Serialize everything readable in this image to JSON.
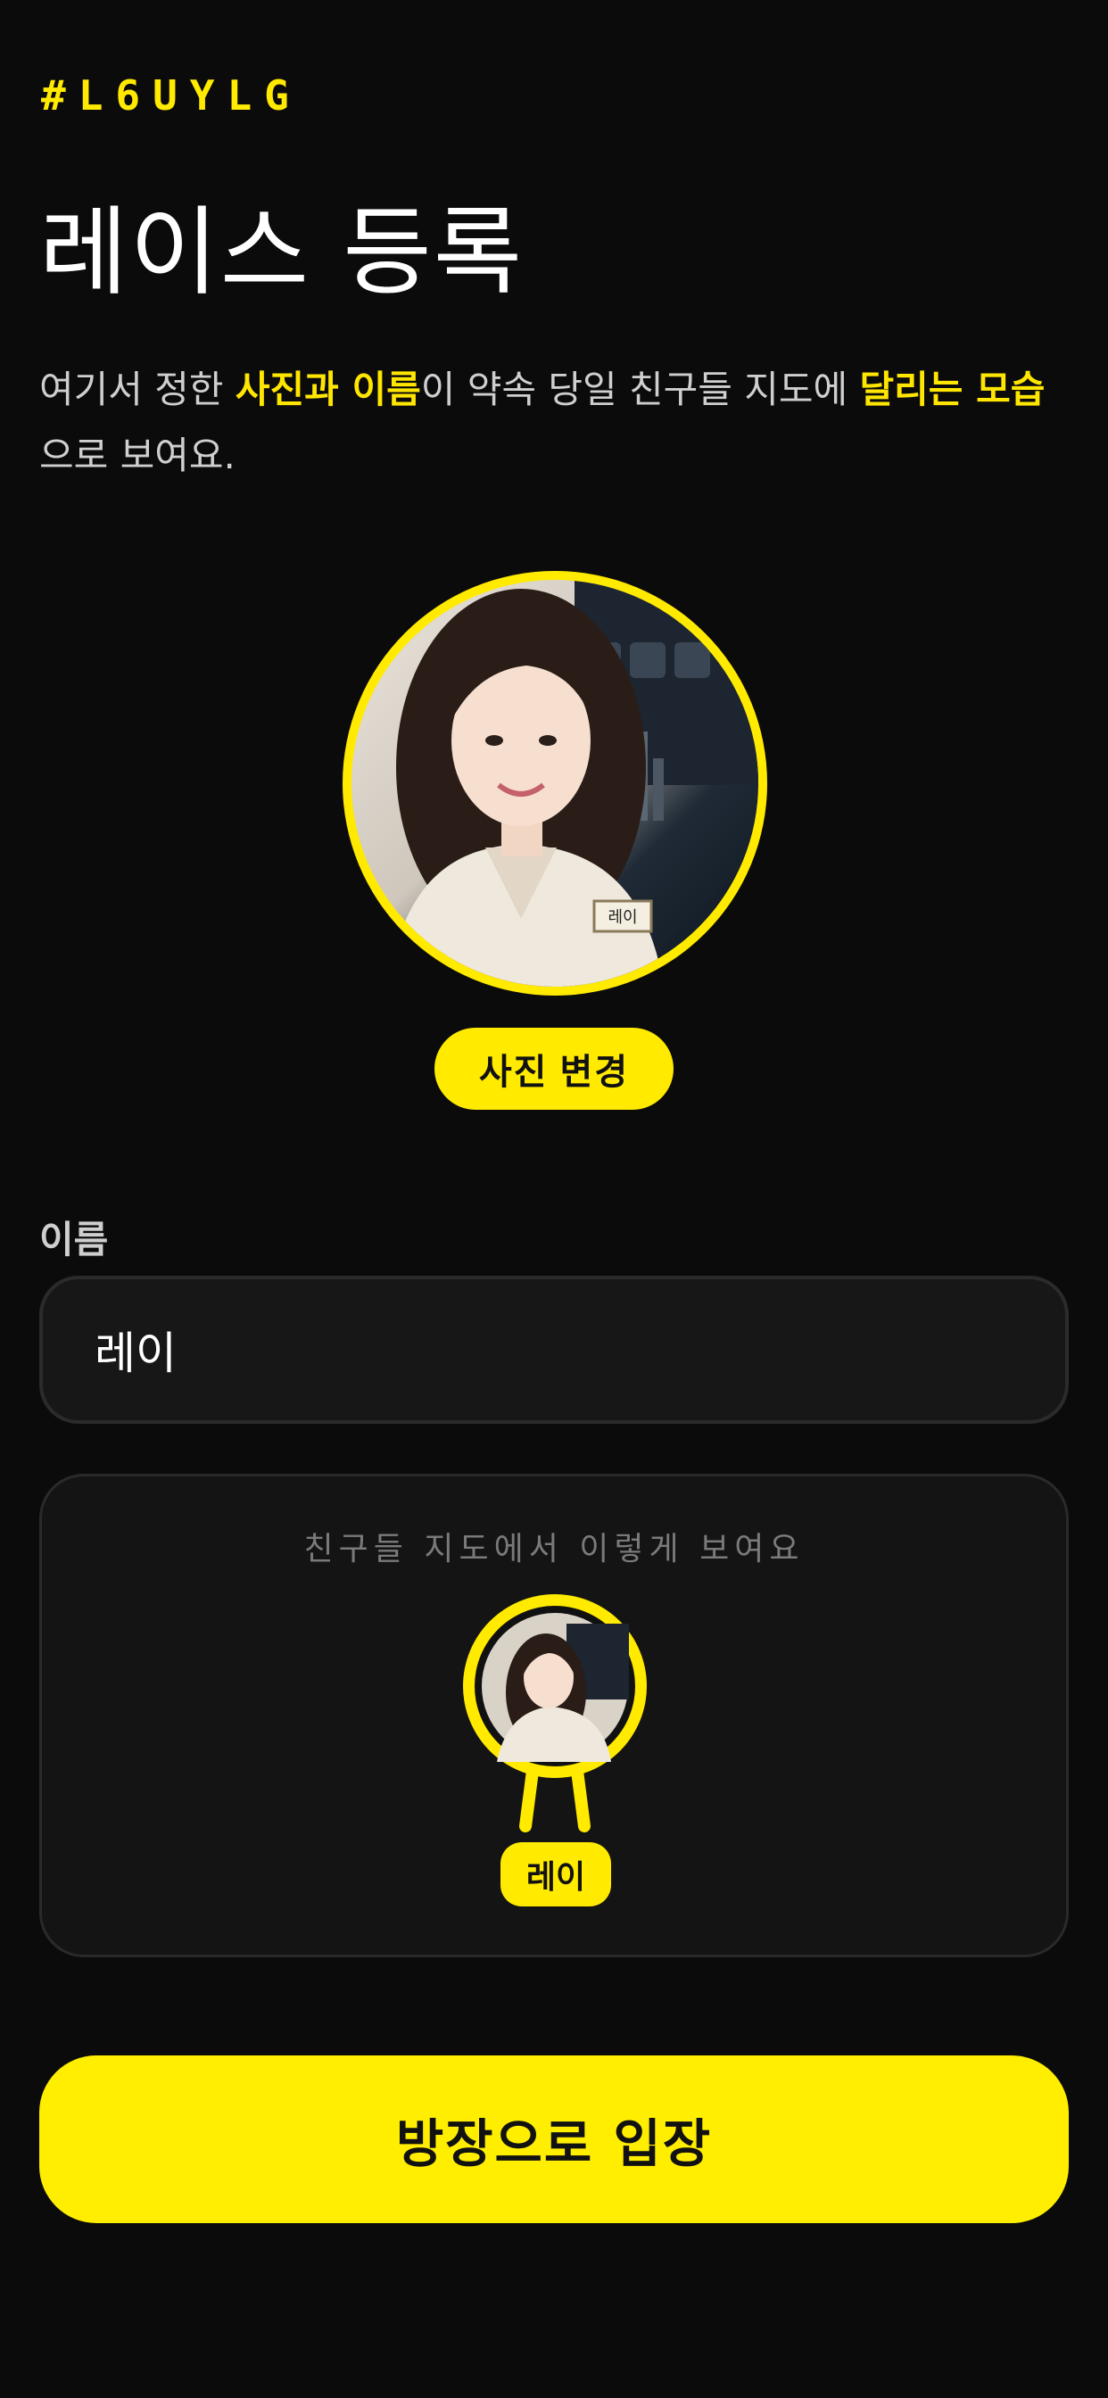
{
  "header": {
    "hashtag": "#L6UYLG",
    "title": "레이스 등록"
  },
  "description": {
    "part1": "여기서 정한 ",
    "highlight1": "사진과 이름",
    "part2": "이 약속 당일 친구들 지도에 ",
    "highlight2": "달리는 모습",
    "part3": "으로 보여요."
  },
  "photo": {
    "change_label": "사진 변경",
    "badge_text": "레이"
  },
  "name_field": {
    "label": "이름",
    "value": "레이"
  },
  "preview": {
    "caption": "친구들 지도에서 이렇게 보여요",
    "marker_name": "레이"
  },
  "footer": {
    "enter_label": "방장으로 입장"
  },
  "colors": {
    "accent": "#FFEA00",
    "background": "#0B0B0B"
  }
}
